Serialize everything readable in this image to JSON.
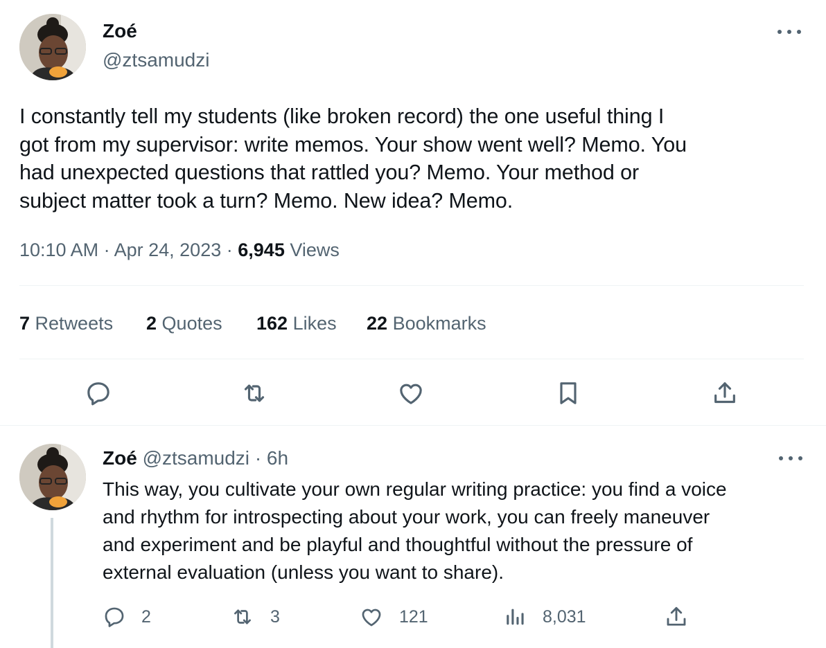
{
  "main_tweet": {
    "author_name": "Zoé",
    "handle": "@ztsamudzi",
    "text": "I constantly tell my students (like broken record) the one useful thing I\ngot from my supervisor: write memos. Your show went well? Memo. You\nhad unexpected questions that rattled you? Memo. Your method or\nsubject matter took a turn? Memo. New idea? Memo.",
    "time": "10:10 AM",
    "date": "Apr 24, 2023",
    "separator": "·",
    "views_count": "6,945",
    "views_label": "Views",
    "stats": {
      "retweets_count": "7",
      "retweets_label": "Retweets",
      "quotes_count": "2",
      "quotes_label": "Quotes",
      "likes_count": "162",
      "likes_label": "Likes",
      "bookmarks_count": "22",
      "bookmarks_label": "Bookmarks"
    },
    "actions": [
      "reply-icon",
      "retweet-icon",
      "like-icon",
      "bookmark-icon",
      "share-icon"
    ]
  },
  "reply": {
    "author_name": "Zoé",
    "handle": "@ztsamudzi",
    "separator": "·",
    "time_ago": "6h",
    "text": "This way, you cultivate your own regular writing practice: you find a voice\nand rhythm for introspecting about your work, you can freely maneuver\nand experiment and be playful and thoughtful without the pressure of\nexternal evaluation (unless you want to share).",
    "replies": "2",
    "retweets": "3",
    "likes": "121",
    "views": "8,031"
  },
  "colors": {
    "text": "#0f1419",
    "muted": "#536471",
    "divider": "#eff3f4",
    "thread_line": "#cfd9de"
  }
}
